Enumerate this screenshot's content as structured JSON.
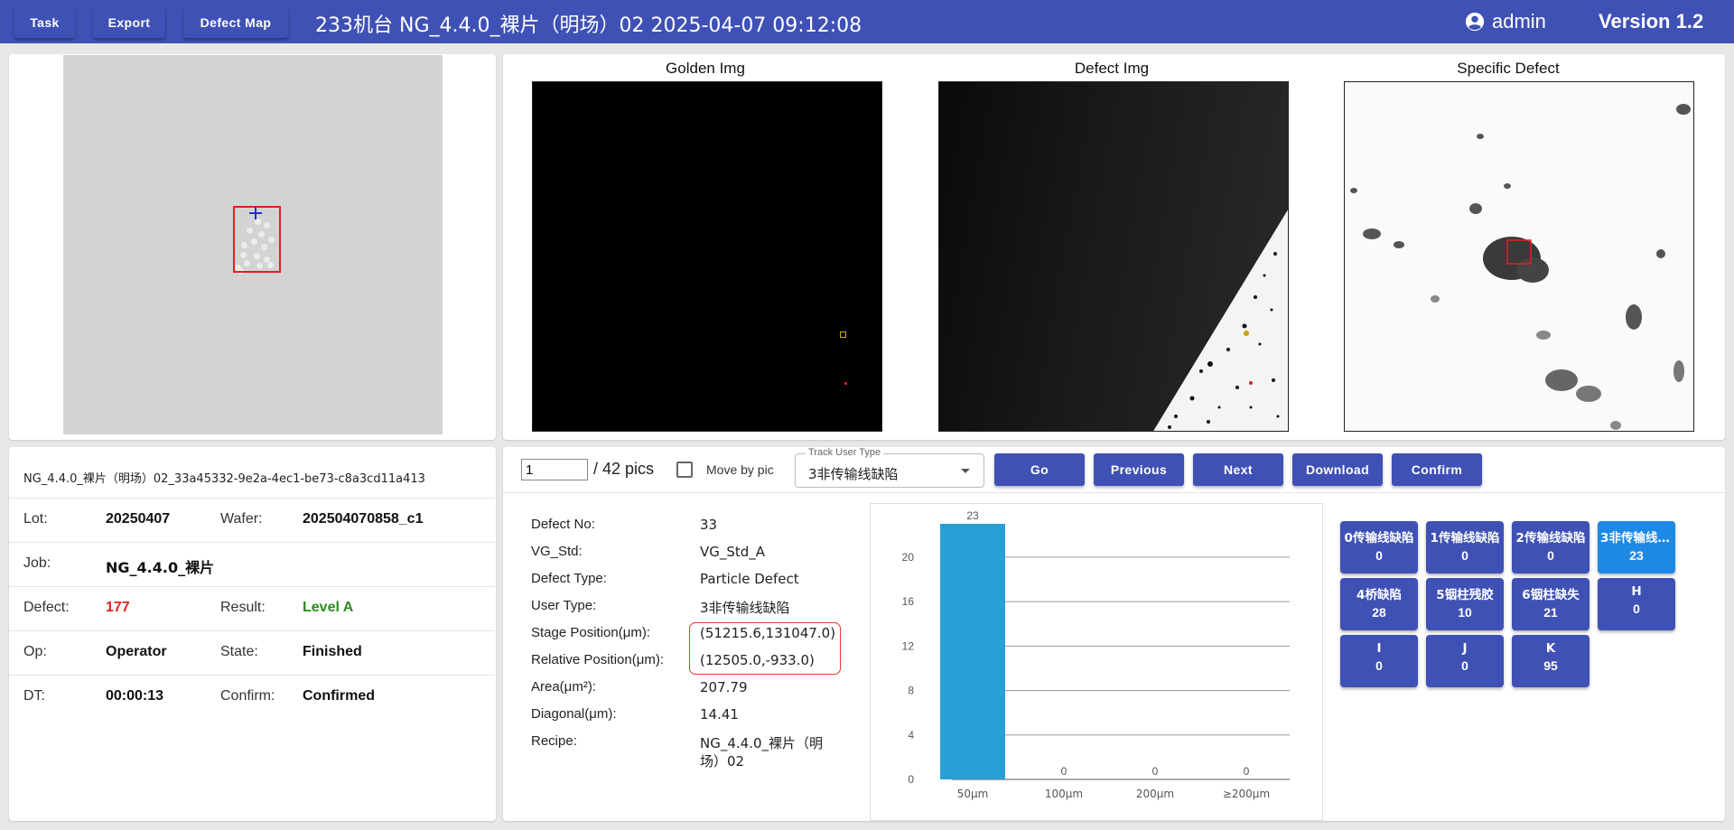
{
  "topbar": {
    "task": "Task",
    "export": "Export",
    "defect_map": "Defect Map",
    "title": "233机台   NG_4.4.0_裸片（明场）02   2025-04-07 09:12:08",
    "user": "admin",
    "version": "Version 1.2",
    "color": "#3f51b5"
  },
  "images": {
    "golden": "Golden Img",
    "defect": "Defect Img",
    "specific": "Specific Defect"
  },
  "info": {
    "file_name": "NG_4.4.0_裸片（明场）02_33a45332-9e2a-4ec1-be73-c8a3cd11a413",
    "lot_label": "Lot:",
    "lot": "20250407",
    "wafer_label": "Wafer:",
    "wafer": "202504070858_c1",
    "job_label": "Job:",
    "job": "NG_4.4.0_裸片",
    "defect_label": "Defect:",
    "defect": "177",
    "result_label": "Result:",
    "result": "Level A",
    "op_label": "Op:",
    "op": "Operator",
    "state_label": "State:",
    "state": "Finished",
    "dt_label": "DT:",
    "dt": "00:00:13",
    "confirm_label": "Confirm:",
    "confirm": "Confirmed"
  },
  "toolbar": {
    "page": "1",
    "total": "/ 42 pics",
    "move_by_pic": "Move by pic",
    "track_label": "Track User Type",
    "track_value": "3非传输线缺陷",
    "go": "Go",
    "previous": "Previous",
    "next": "Next",
    "download": "Download",
    "confirm": "Confirm"
  },
  "details": {
    "defect_no_label": "Defect No:",
    "defect_no": "33",
    "vg_std_label": "VG_Std:",
    "vg_std": "VG_Std_A",
    "defect_type_label": "Defect Type:",
    "defect_type": "Particle Defect",
    "user_type_label": "User Type:",
    "user_type": "3非传输线缺陷",
    "stage_pos_label": "Stage Position(μm):",
    "stage_pos": "(51215.6,131047.0)",
    "rel_pos_label": "Relative Position(μm):",
    "rel_pos": "(12505.0,-933.0)",
    "area_label": "Area(μm²):",
    "area": "207.79",
    "diagonal_label": "Diagonal(μm):",
    "diagonal": "14.41",
    "recipe_label": "Recipe:",
    "recipe_line1": "NG_4.4.0_裸片（明",
    "recipe_line2": "场）02"
  },
  "chart_data": {
    "type": "bar",
    "categories": [
      "50μm",
      "100μm",
      "200μm",
      "≥200μm"
    ],
    "values": [
      23,
      0,
      0,
      0
    ],
    "title": "",
    "xlabel": "",
    "ylabel": "",
    "yticks": [
      0,
      4,
      8,
      12,
      16,
      20
    ],
    "ylim": [
      0,
      23
    ],
    "grid": true,
    "bar_color": "#2a9fd6"
  },
  "categories": [
    {
      "name": "0传输线缺陷",
      "count": "0"
    },
    {
      "name": "1传输线缺陷",
      "count": "0"
    },
    {
      "name": "2传输线缺陷",
      "count": "0"
    },
    {
      "name": "3非传输线缺陷",
      "count": "23"
    },
    {
      "name": "4桥缺陷",
      "count": "28"
    },
    {
      "name": "5铟柱残胶",
      "count": "10"
    },
    {
      "name": "6铟柱缺失",
      "count": "21"
    },
    {
      "name": "H",
      "count": "0"
    },
    {
      "name": "I",
      "count": "0"
    },
    {
      "name": "J",
      "count": "0"
    },
    {
      "name": "K",
      "count": "95"
    }
  ]
}
